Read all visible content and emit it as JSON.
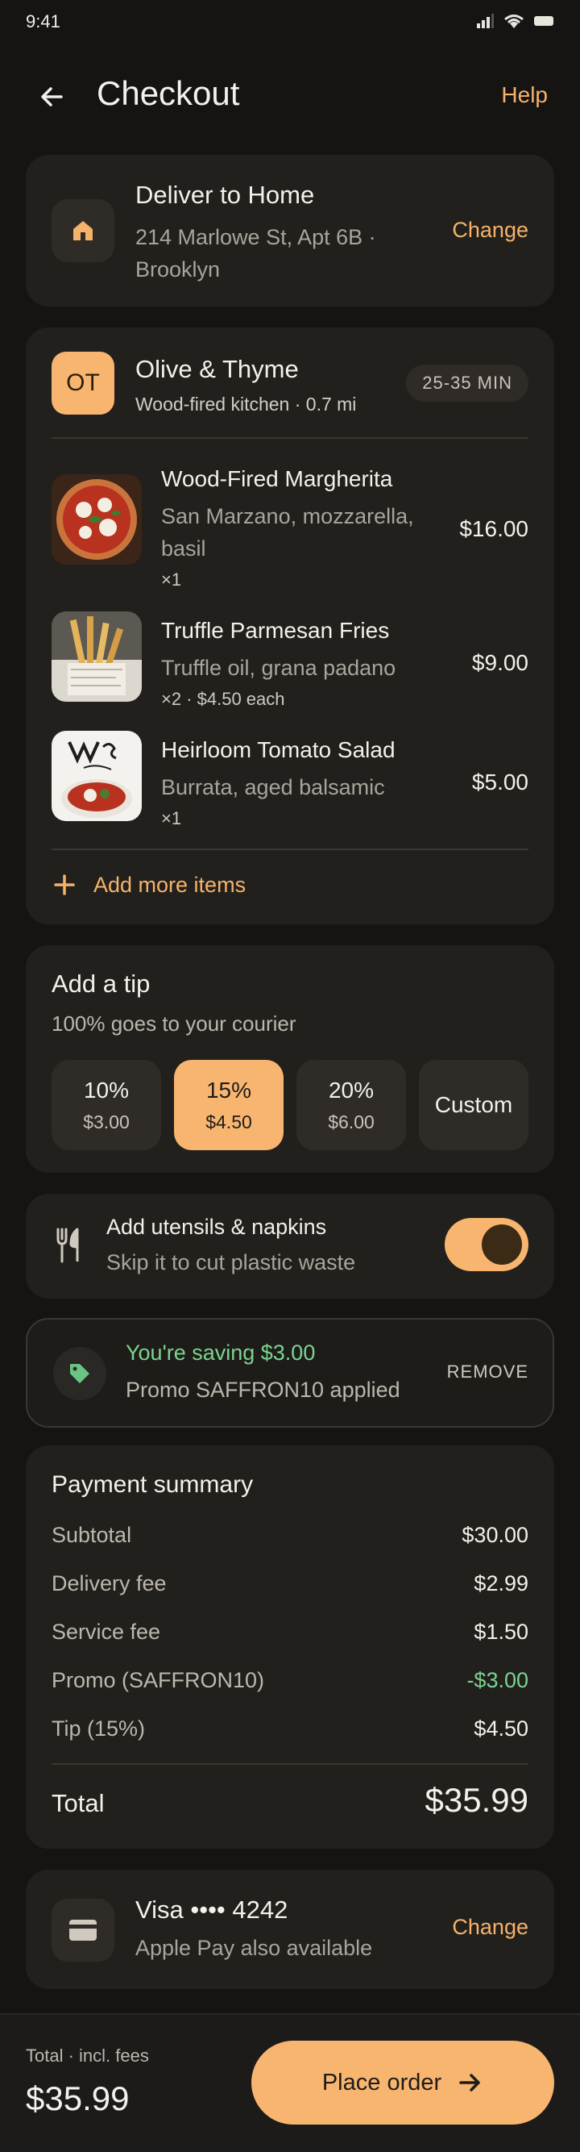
{
  "status_bar": {
    "time": "9:41"
  },
  "header": {
    "title": "Checkout",
    "help_label": "Help"
  },
  "delivery": {
    "title": "Deliver to Home",
    "address_line1": "214 Marlowe St, Apt 6B ·",
    "address_line2": "Brooklyn",
    "change_label": "Change"
  },
  "restaurant": {
    "initials": "OT",
    "name": "Olive & Thyme",
    "subtitle": "Wood-fired kitchen · 0.7 mi",
    "eta": "25-35 MIN"
  },
  "items": [
    {
      "name": "Wood-Fired Margherita",
      "desc_line1": "San Marzano, mozzarella,",
      "desc_line2": "basil",
      "qty": "×1",
      "price": "$16.00"
    },
    {
      "name": "Truffle Parmesan Fries",
      "desc_line1": "Truffle oil, grana padano",
      "qty": "×2  ·  $4.50 each",
      "price": "$9.00"
    },
    {
      "name": "Heirloom Tomato Salad",
      "desc_line1": "Burrata, aged balsamic",
      "qty": "×1",
      "price": "$5.00"
    }
  ],
  "add_more_label": "Add more items",
  "tip": {
    "title": "Add a tip",
    "subtitle": "100% goes to your courier",
    "options": [
      {
        "pct": "10%",
        "amount": "$3.00",
        "selected": false
      },
      {
        "pct": "15%",
        "amount": "$4.50",
        "selected": true
      },
      {
        "pct": "20%",
        "amount": "$6.00",
        "selected": false
      },
      {
        "pct": "Custom",
        "amount": "",
        "selected": false
      }
    ]
  },
  "utensils": {
    "title": "Add utensils & napkins",
    "subtitle": "Skip it to cut plastic waste",
    "enabled": true
  },
  "promo": {
    "title": "You're saving $3.00",
    "subtitle": "Promo SAFFRON10 applied",
    "remove_label": "REMOVE"
  },
  "summary": {
    "title": "Payment summary",
    "rows": [
      {
        "label": "Subtotal",
        "value": "$30.00"
      },
      {
        "label": "Delivery fee",
        "value": "$2.99"
      },
      {
        "label": "Service fee",
        "value": "$1.50"
      },
      {
        "label": "Promo (SAFFRON10)",
        "value": "-$3.00"
      },
      {
        "label": "Tip (15%)",
        "value": "$4.50"
      }
    ],
    "total_label": "Total",
    "total_value": "$35.99"
  },
  "payment": {
    "title": "Visa •••• 4242",
    "subtitle": "Apple Pay also available",
    "change_label": "Change"
  },
  "footer": {
    "caption": "Total · incl. fees",
    "total": "$35.99",
    "button_label": "Place order"
  },
  "colors": {
    "accent": "#f8b56f",
    "promo_green": "#7cd391",
    "background": "#151412",
    "card": "#22201d"
  }
}
